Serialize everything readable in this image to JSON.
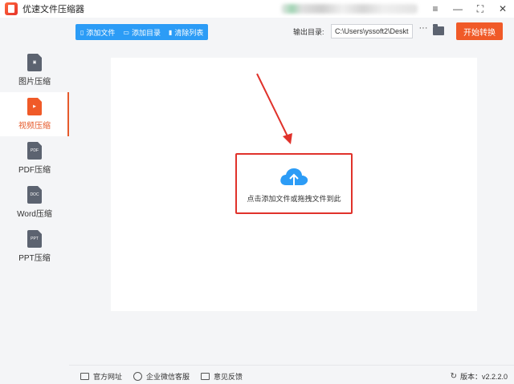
{
  "app": {
    "title": "优速文件压缩器"
  },
  "window": {
    "menu_icon": "≡",
    "min_icon": "—",
    "max_icon": "⛶",
    "close_icon": "✕"
  },
  "sidebar": {
    "items": [
      {
        "label": "图片压缩",
        "icon_text": "▣",
        "active": false
      },
      {
        "label": "视频压缩",
        "icon_text": "▶",
        "active": true
      },
      {
        "label": "PDF压缩",
        "icon_text": "PDF",
        "active": false
      },
      {
        "label": "Word压缩",
        "icon_text": "DOC",
        "active": false
      },
      {
        "label": "PPT压缩",
        "icon_text": "PPT",
        "active": false
      }
    ]
  },
  "toolbar": {
    "add_file": "添加文件",
    "add_dir": "添加目录",
    "clear_list": "清除列表",
    "output_label": "输出目录:",
    "output_path": "C:\\Users\\yssoft2\\Deskt",
    "more": "···",
    "start": "开始转换"
  },
  "dropzone": {
    "text": "点击添加文件或拖拽文件到此"
  },
  "footer": {
    "website": "官方网址",
    "wechat": "企业微信客服",
    "feedback": "意见反馈",
    "version_label": "版本：v2.2.2.0"
  },
  "colors": {
    "accent": "#f05a28",
    "blue": "#2c9cf6",
    "highlight_red": "#e0322b"
  }
}
